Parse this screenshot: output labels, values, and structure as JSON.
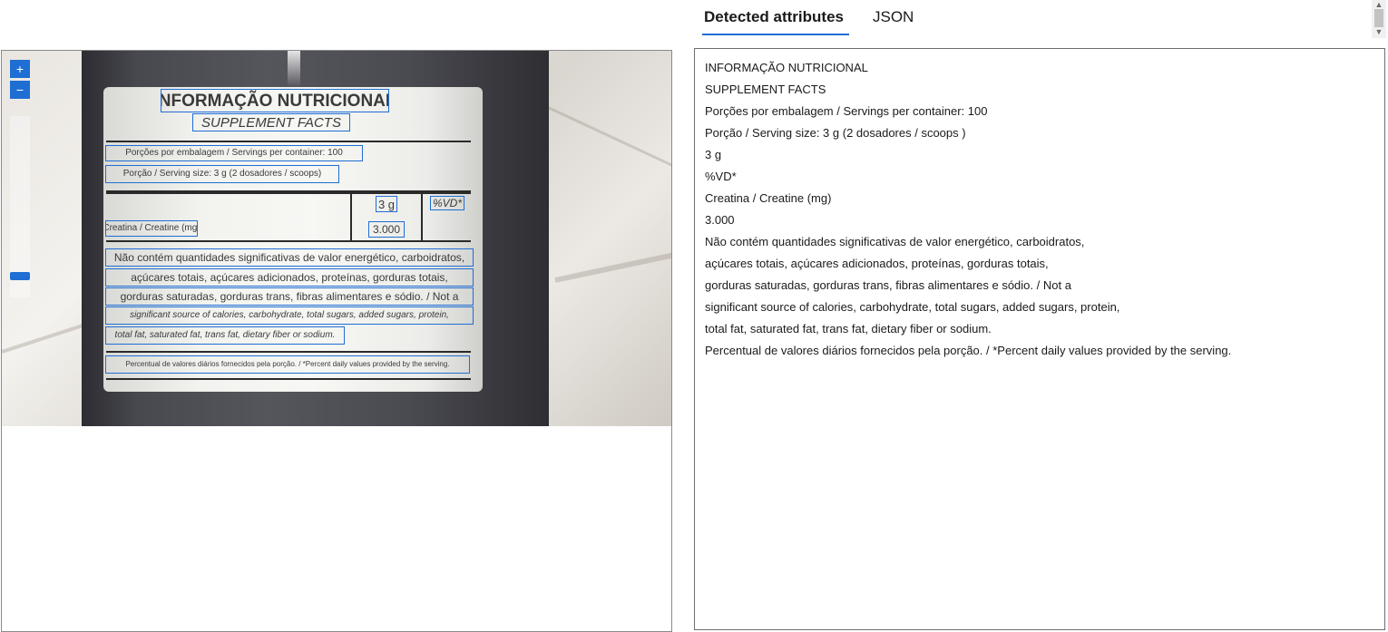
{
  "tabs": [
    {
      "label": "Detected attributes",
      "active": true
    },
    {
      "label": "JSON",
      "active": false
    }
  ],
  "viewer": {
    "zoom_in_label": "+",
    "zoom_out_label": "−",
    "ocr_boxes": {
      "title": "INFORMAÇÃO NUTRICIONAL",
      "subtitle": "SUPPLEMENT FACTS",
      "servings": "Porções por embalagem / Servings per container: 100",
      "serving_size": "Porção / Serving size: 3 g (2 dosadores / scoops)",
      "col_3g": "3 g",
      "col_vd": "%VD*",
      "creatine": "Creatina / Creatine (mg)",
      "creatine_value": "3.000",
      "body_1": "Não contém quantidades significativas de valor energético, carboidratos,",
      "body_2": "açúcares totais, açúcares adicionados, proteínas, gorduras totais,",
      "body_3": "gorduras saturadas, gorduras trans, fibras alimentares e sódio. / Not a",
      "body_4": "significant source of calories, carbohydrate, total sugars, added sugars, protein,",
      "body_5": "total fat, saturated fat, trans fat, dietary fiber or sodium.",
      "footer": "Percentual de valores diários fornecidos pela porção. / *Percent daily values provided by the serving."
    }
  },
  "detected_text": [
    "INFORMAÇÃO NUTRICIONAL",
    "SUPPLEMENT FACTS",
    "Porções por embalagem / Servings per container: 100",
    "Porção / Serving size: 3 g (2 dosadores / scoops )",
    "3 g",
    "%VD*",
    "Creatina / Creatine (mg)",
    "3.000",
    "Não contém quantidades significativas de valor energético, carboidratos,",
    "açúcares totais, açúcares adicionados, proteínas, gorduras totais,",
    "gorduras saturadas, gorduras trans, fibras alimentares e sódio. / Not a",
    "significant source of calories, carbohydrate, total sugars, added sugars, protein,",
    "total fat, saturated fat, trans fat, dietary fiber or sodium.",
    "Percentual de valores diários fornecidos pela porção. / *Percent daily values provided by the serving."
  ],
  "colors": {
    "accent": "#1f6ed4",
    "ocr_box": "#1f6ed4",
    "jar": "#4a4a51"
  }
}
